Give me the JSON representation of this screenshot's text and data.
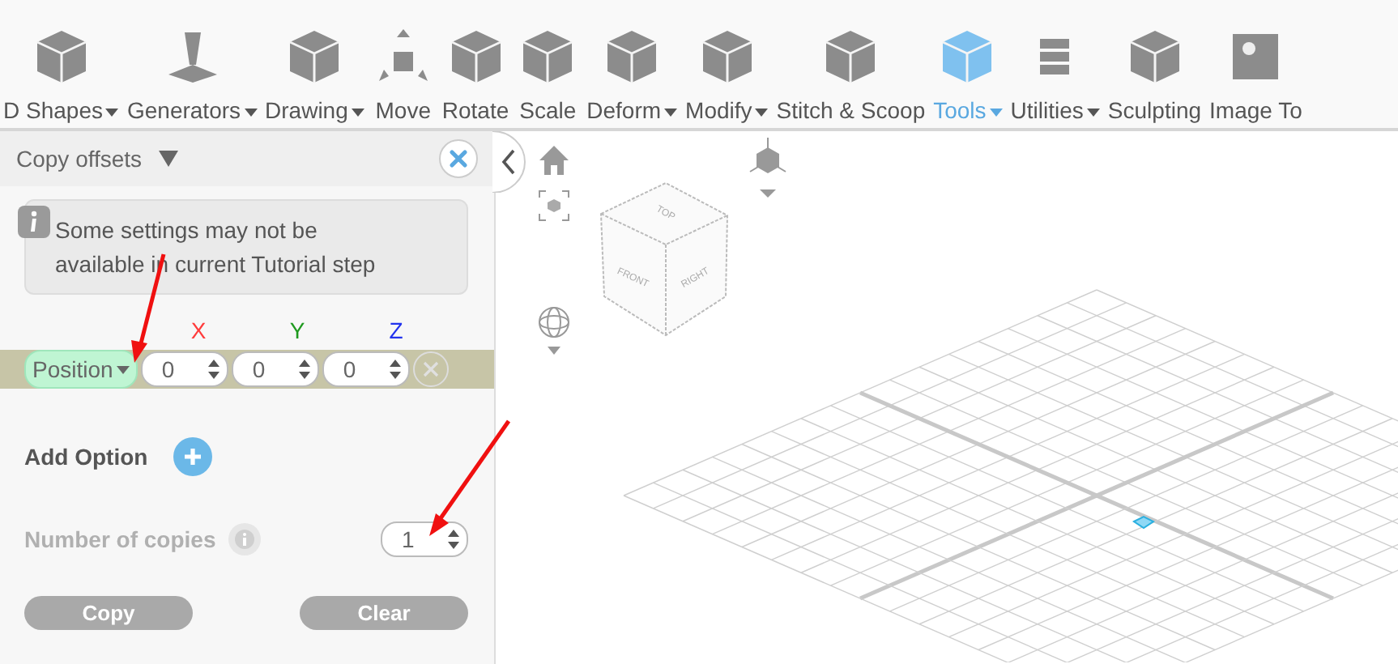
{
  "toolbar": [
    {
      "label": "D Shapes",
      "dropdown": true,
      "selected": false
    },
    {
      "label": "Generators",
      "dropdown": true,
      "selected": false
    },
    {
      "label": "Drawing",
      "dropdown": true,
      "selected": false
    },
    {
      "label": "Move",
      "dropdown": false,
      "selected": false
    },
    {
      "label": "Rotate",
      "dropdown": false,
      "selected": false
    },
    {
      "label": "Scale",
      "dropdown": false,
      "selected": false
    },
    {
      "label": "Deform",
      "dropdown": true,
      "selected": false
    },
    {
      "label": "Modify",
      "dropdown": true,
      "selected": false
    },
    {
      "label": "Stitch & Scoop",
      "dropdown": false,
      "selected": false
    },
    {
      "label": "Tools",
      "dropdown": true,
      "selected": true
    },
    {
      "label": "Utilities",
      "dropdown": true,
      "selected": false
    },
    {
      "label": "Sculpting",
      "dropdown": false,
      "selected": false
    },
    {
      "label": "Image To",
      "dropdown": false,
      "selected": false
    }
  ],
  "panel": {
    "title": "Copy offsets",
    "notice": "Some settings may not be available in current Tutorial step",
    "axes": [
      {
        "label": "X",
        "color": "#ff3b3b"
      },
      {
        "label": "Y",
        "color": "#1f9a1f"
      },
      {
        "label": "Z",
        "color": "#2233ee"
      }
    ],
    "option": {
      "type": "Position",
      "values": [
        "0",
        "0",
        "0"
      ]
    },
    "add_option": "Add Option",
    "copies": {
      "label": "Number of copies",
      "value": "1",
      "disabled": true
    },
    "buttons": [
      {
        "label": "Copy",
        "disabled": true
      },
      {
        "label": "Clear",
        "disabled": true
      }
    ]
  },
  "viewport": {
    "view_cube": {
      "faces": [
        "TOP",
        "FRONT",
        "RIGHT"
      ]
    }
  }
}
